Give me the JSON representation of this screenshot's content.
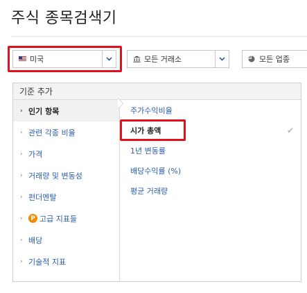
{
  "page": {
    "title": "주식 종목검색기"
  },
  "filters": {
    "country": {
      "label": "미국",
      "icon": "us-flag-icon"
    },
    "exchange": {
      "label": "모든 거래소",
      "icon": "bank-icon"
    },
    "sector": {
      "label": "모든 업종",
      "icon": "pie-chart-icon"
    }
  },
  "criteria": {
    "header": "기준 추가",
    "categories": [
      {
        "label": "인기 항목"
      },
      {
        "label": "관련 각종 비율"
      },
      {
        "label": "가격"
      },
      {
        "label": "거래량 및 변동성"
      },
      {
        "label": "펀더멘탈"
      },
      {
        "label": "고급 지표들",
        "badge": "P"
      },
      {
        "label": "배당"
      },
      {
        "label": "기술적 지표"
      }
    ],
    "items": [
      {
        "label": "주가수익비율"
      },
      {
        "label": "시가 총액"
      },
      {
        "label": "1년 변동률"
      },
      {
        "label": "배당수익률 (%)"
      },
      {
        "label": "평균 거래량"
      }
    ],
    "check_mark": "✔"
  },
  "colors": {
    "link": "#2a5db0",
    "highlight": "#e0101c",
    "premium": "#f08a00"
  }
}
